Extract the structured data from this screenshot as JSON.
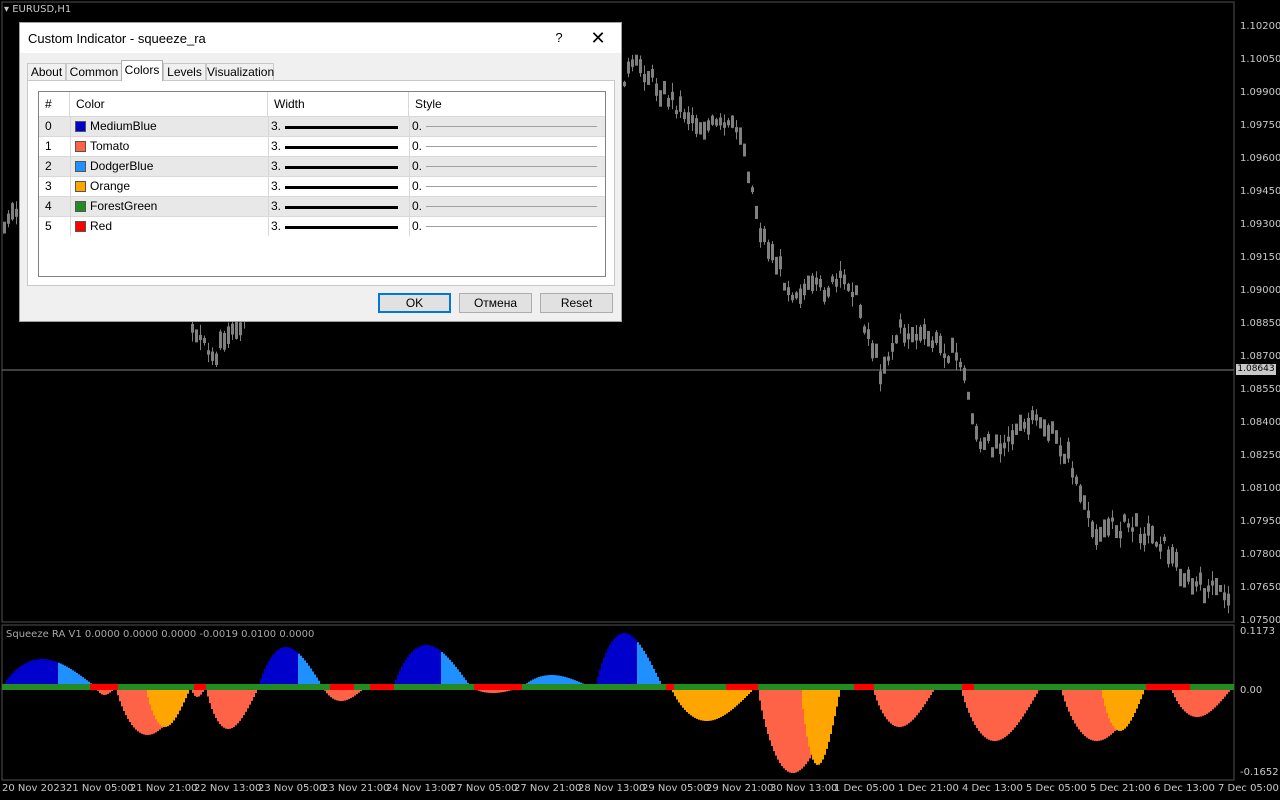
{
  "chart": {
    "symbol": "EURUSD,H1",
    "price_labels": [
      "1.10200",
      "1.10050",
      "1.09900",
      "1.09750",
      "1.09600",
      "1.09450",
      "1.09300",
      "1.09150",
      "1.09000",
      "1.08850",
      "1.08700",
      "1.08550",
      "1.08400",
      "1.08250",
      "1.08100",
      "1.07950",
      "1.07800",
      "1.07650",
      "1.07500"
    ],
    "current_price": "1.08643",
    "time_labels": [
      "20 Nov 2023",
      "21 Nov 05:00",
      "21 Nov 21:00",
      "22 Nov 13:00",
      "23 Nov 05:00",
      "23 Nov 21:00",
      "24 Nov 13:00",
      "27 Nov 05:00",
      "27 Nov 21:00",
      "28 Nov 13:00",
      "29 Nov 05:00",
      "29 Nov 21:00",
      "30 Nov 13:00",
      "1 Dec 05:00",
      "1 Dec 21:00",
      "4 Dec 13:00",
      "5 Dec 05:00",
      "5 Dec 21:00",
      "6 Dec 13:00",
      "7 Dec 05:00"
    ],
    "indicator_label": "Squeeze RA  V1 0.0000 0.0000 0.0000 -0.0019 0.0100 0.0000",
    "indicator_scale": {
      "top": "0.1173",
      "zero": "0.00",
      "bottom": "-0.1652"
    },
    "colors": {
      "background": "#000000",
      "candles": "#808080",
      "grid": "#505050"
    }
  },
  "dialog": {
    "title": "Custom Indicator - squeeze_ra",
    "help_label": "?",
    "close_label": "✕",
    "tabs": [
      {
        "label": "About"
      },
      {
        "label": "Common"
      },
      {
        "label": "Colors"
      },
      {
        "label": "Levels"
      },
      {
        "label": "Visualization"
      }
    ],
    "active_tab": "Colors",
    "columns": {
      "num": "#",
      "color": "Color",
      "width": "Width",
      "style": "Style"
    },
    "rows": [
      {
        "num": "0",
        "color": "MediumBlue",
        "hex": "#0000cd",
        "width": "3.",
        "style": "0."
      },
      {
        "num": "1",
        "color": "Tomato",
        "hex": "#ff6347",
        "width": "3.",
        "style": "0."
      },
      {
        "num": "2",
        "color": "DodgerBlue",
        "hex": "#1e90ff",
        "width": "3.",
        "style": "0."
      },
      {
        "num": "3",
        "color": "Orange",
        "hex": "#ffa500",
        "width": "3.",
        "style": "0."
      },
      {
        "num": "4",
        "color": "ForestGreen",
        "hex": "#228b22",
        "width": "3.",
        "style": "0."
      },
      {
        "num": "5",
        "color": "Red",
        "hex": "#ff0000",
        "width": "3.",
        "style": "0."
      }
    ],
    "buttons": {
      "ok": "OK",
      "cancel": "Отмена",
      "reset": "Reset"
    }
  }
}
